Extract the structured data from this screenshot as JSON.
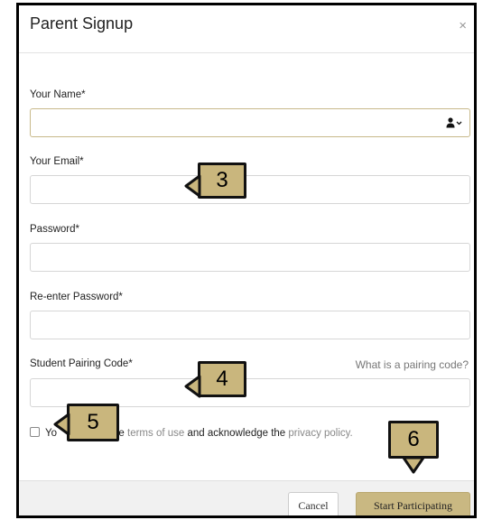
{
  "modal": {
    "title": "Parent Signup",
    "close": "×"
  },
  "form": {
    "name_label": "Your Name*",
    "email_label": "Your Email*",
    "password_label": "Password*",
    "reenter_label": "Re-enter Password*",
    "pairing_label": "Student Pairing Code*",
    "pairing_help": "What is a pairing code?",
    "terms": {
      "prefix": "Yo",
      "middle": "he ",
      "terms_link": "terms of use",
      "and_text": " and acknowledge the ",
      "privacy_link": "privacy policy."
    }
  },
  "footer": {
    "cancel": "Cancel",
    "submit": "Start Participating"
  },
  "callouts": {
    "c3": "3",
    "c4": "4",
    "c5": "5",
    "c6": "6"
  },
  "colors": {
    "callout_fill": "#c9b67d",
    "primary_button": "#c9b882",
    "active_border": "#c8b98a"
  }
}
